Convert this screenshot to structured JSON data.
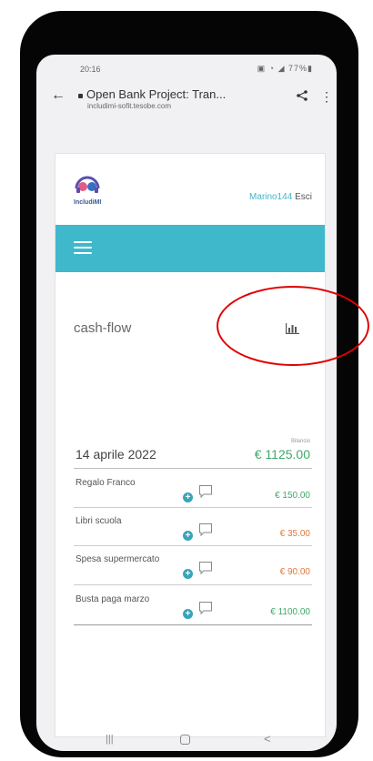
{
  "status_bar": {
    "time": "20:16",
    "icons": "▣ ◔ ◢ 77%▮"
  },
  "browser": {
    "title": "Open Bank Project: Tran...",
    "host": "includimi-sofit.tesobe.com",
    "back_icon": "←",
    "menu_icon": "⋮"
  },
  "header": {
    "logo_text": "IncludiMI",
    "username": "Marino144",
    "logout": "Esci"
  },
  "section": {
    "title": "cash-flow"
  },
  "day": {
    "date": "14 aprile 2022",
    "balance_label": "Bilancio",
    "balance": "€ 1125.00"
  },
  "transactions": [
    {
      "name": "Regalo Franco",
      "amount": "€ 150.00",
      "color": "#3fa86a"
    },
    {
      "name": "Libri scuola",
      "amount": "€ 35.00",
      "color": "#e07a3a"
    },
    {
      "name": "Spesa supermercato",
      "amount": "€ 90.00",
      "color": "#e07a3a"
    },
    {
      "name": "Busta paga marzo",
      "amount": "€ 1100.00",
      "color": "#3fa86a"
    }
  ],
  "colors": {
    "accent": "#40b8cc",
    "income": "#3fa86a",
    "expense": "#e07a3a",
    "annotation": "#e00000"
  },
  "android_nav": {
    "recent": "|||",
    "back": "<"
  }
}
